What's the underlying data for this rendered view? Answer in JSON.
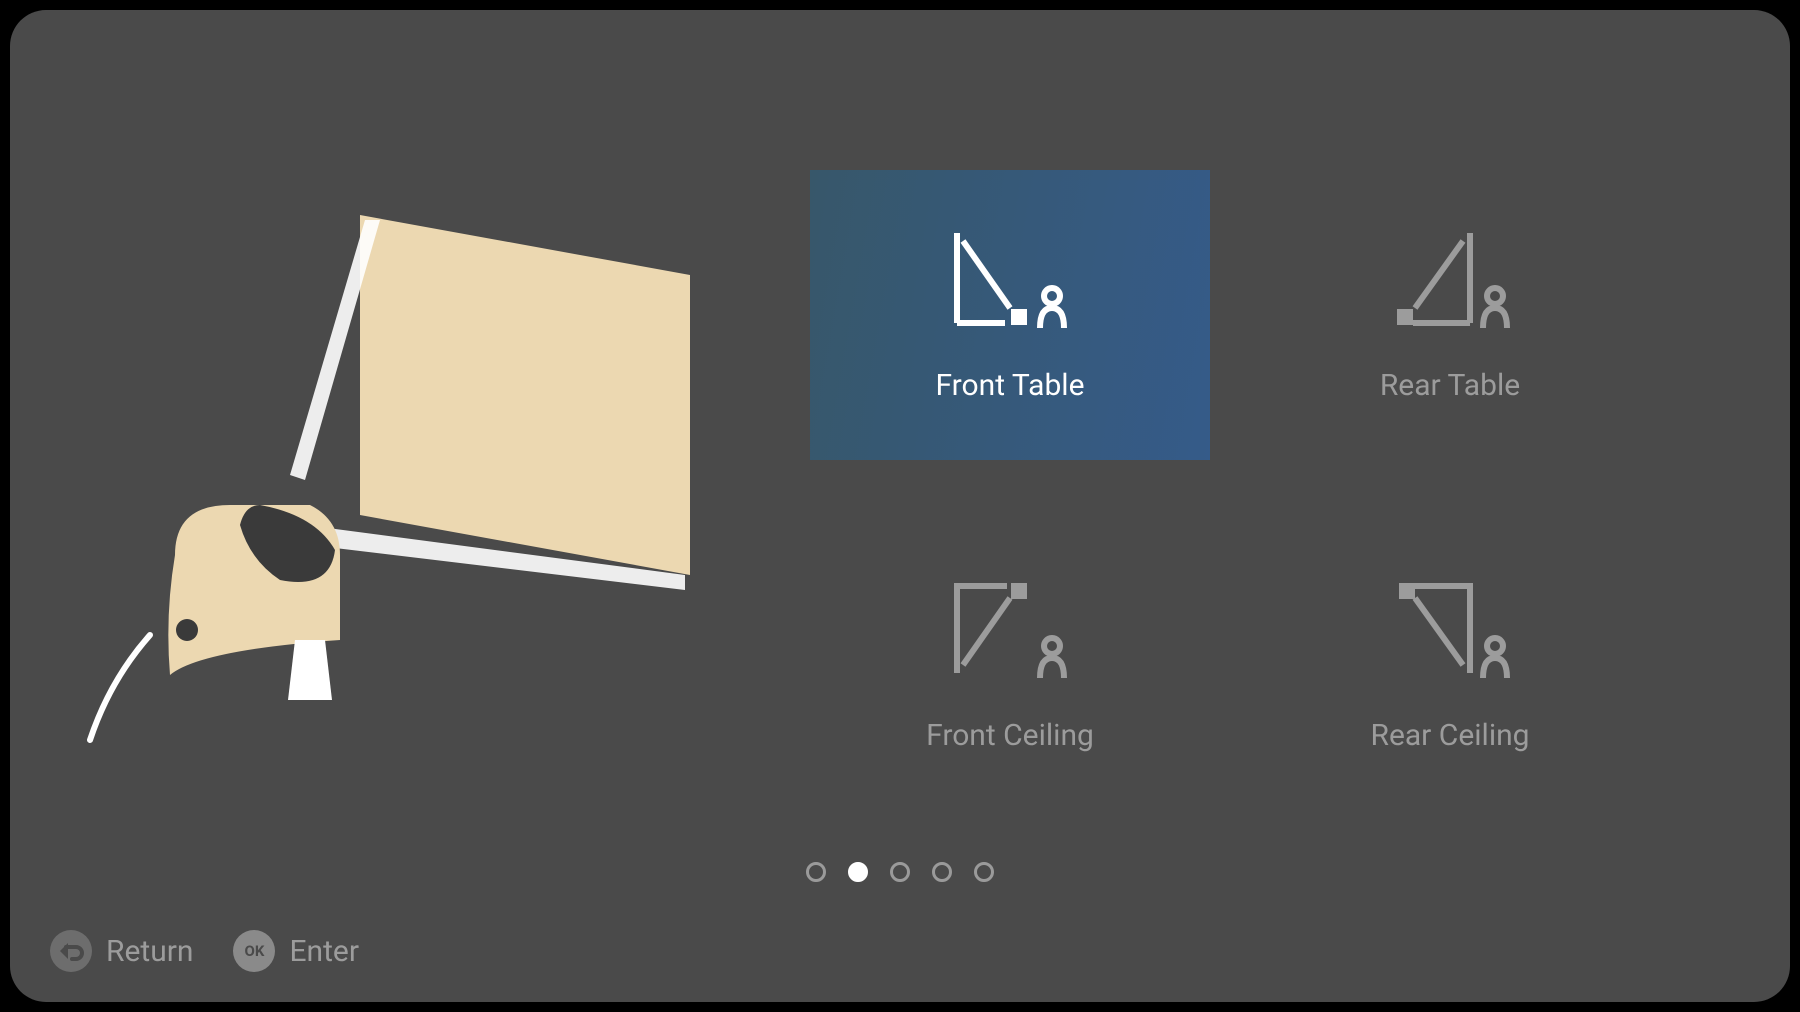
{
  "options": [
    {
      "id": "front-table",
      "label": "Front Table",
      "selected": true
    },
    {
      "id": "rear-table",
      "label": "Rear Table",
      "selected": false
    },
    {
      "id": "front-ceiling",
      "label": "Front Ceiling",
      "selected": false
    },
    {
      "id": "rear-ceiling",
      "label": "Rear Ceiling",
      "selected": false
    }
  ],
  "pagination": {
    "total": 5,
    "current": 2
  },
  "hints": {
    "return_label": "Return",
    "enter_label": "Enter",
    "ok_glyph": "OK"
  },
  "colors": {
    "background": "#4a4a4a",
    "inactive_text": "#9c9c9c",
    "active_text": "#ffffff",
    "selected_bg_from": "#37576a",
    "selected_bg_to": "#355b89",
    "illust_beige": "#ecd8b1"
  }
}
